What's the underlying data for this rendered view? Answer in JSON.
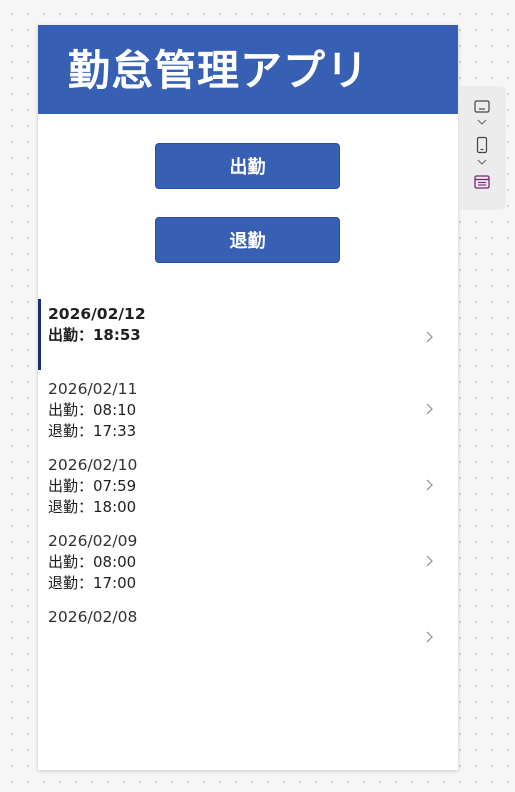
{
  "header": {
    "title": "勤怠管理アプリ"
  },
  "buttons": {
    "clock_in": "出勤",
    "clock_out": "退勤"
  },
  "records": [
    {
      "date": "2026/02/12",
      "clock_in": "出勤：18:53",
      "clock_out": ""
    },
    {
      "date": "2026/02/11",
      "clock_in": "出勤：08:10",
      "clock_out": "退勤：17:33"
    },
    {
      "date": "2026/02/10",
      "clock_in": "出勤：07:59",
      "clock_out": "退勤：18:00"
    },
    {
      "date": "2026/02/09",
      "clock_in": "出勤：08:00",
      "clock_out": "退勤：17:00"
    },
    {
      "date": "2026/02/08",
      "clock_in": "",
      "clock_out": ""
    }
  ],
  "side_panel": {
    "icons": [
      "desktop-layout-icon",
      "chevron-down-icon",
      "phone-layout-icon",
      "chevron-down-icon",
      "form-layout-icon"
    ]
  },
  "colors": {
    "accent": "#3760b4",
    "selection_bar": "#1c2f6e",
    "form_icon": "#742774"
  }
}
